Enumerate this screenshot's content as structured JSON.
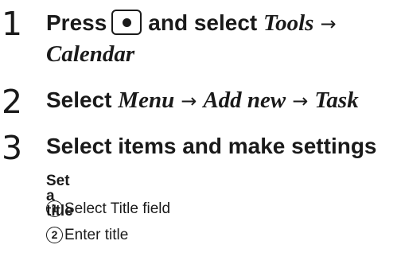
{
  "steps": [
    {
      "number": "1",
      "prefix": "Press",
      "key_icon": "center-select-key-icon",
      "middle": "and select",
      "path_a": "Tools",
      "path_b": "Calendar"
    },
    {
      "number": "2",
      "prefix": "Select",
      "path_a": "Menu",
      "path_b": "Add new",
      "path_c": "Task"
    },
    {
      "number": "3",
      "text": "Select items and make settings",
      "section_title": "Set a title",
      "substeps": [
        {
          "marker": "1",
          "text": "Select Title field"
        },
        {
          "marker": "2",
          "text": "Enter title"
        }
      ]
    }
  ],
  "arrow_symbol": "→"
}
